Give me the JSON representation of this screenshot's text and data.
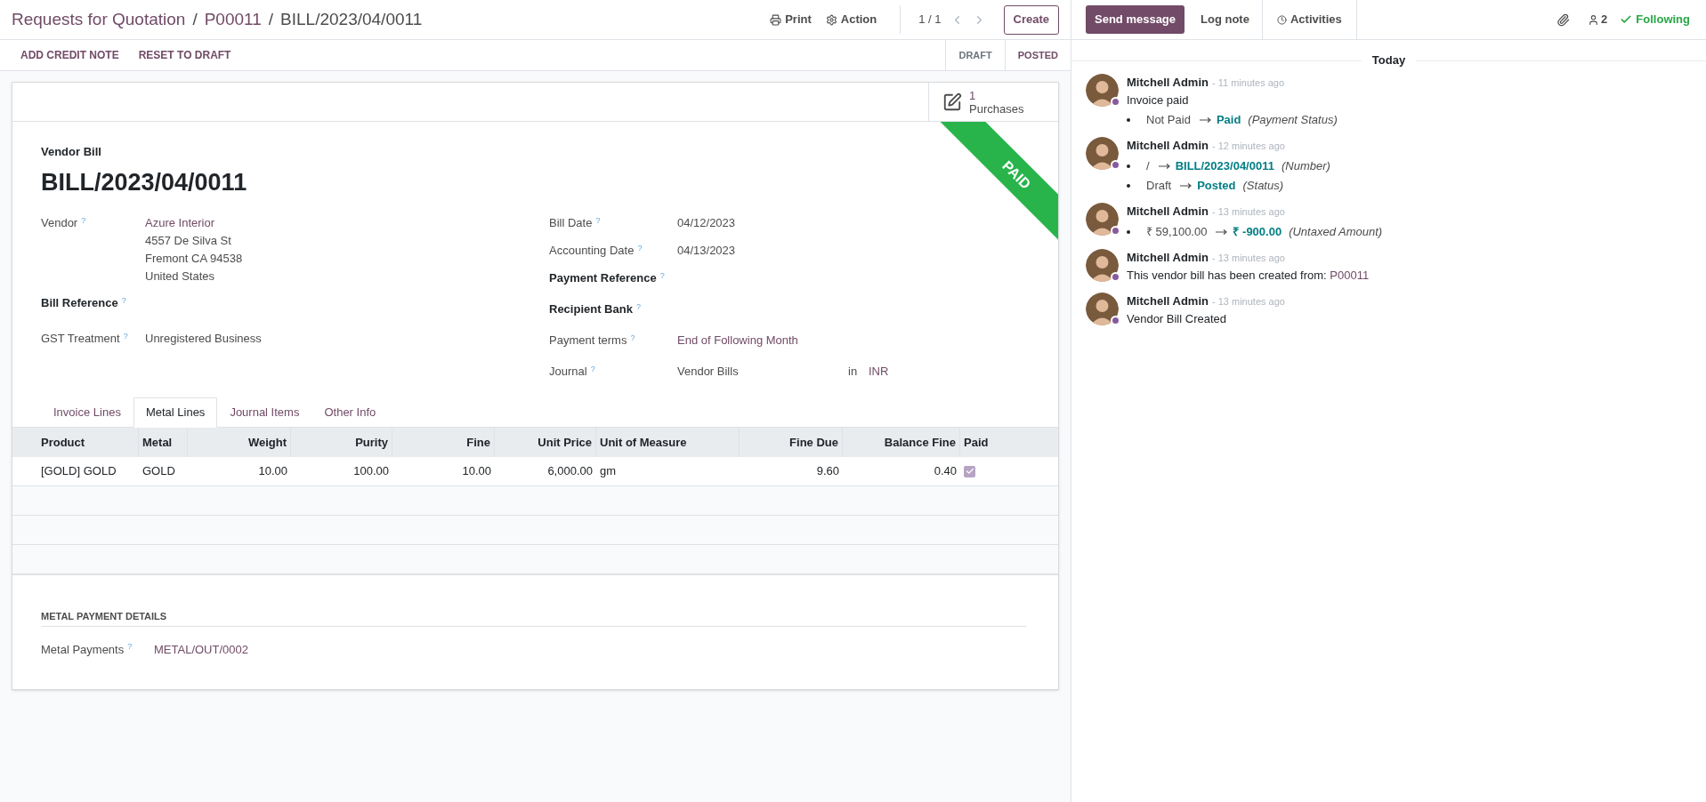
{
  "breadcrumbs": [
    {
      "label": "Requests for Quotation",
      "kind": "link"
    },
    {
      "label": "P00011",
      "kind": "link"
    },
    {
      "label": "BILL/2023/04/0011",
      "kind": "current"
    }
  ],
  "toolbar": {
    "print": "Print",
    "action": "Action",
    "pager": "1 / 1",
    "create": "Create"
  },
  "actions": [
    "ADD CREDIT NOTE",
    "RESET TO DRAFT"
  ],
  "stages": [
    {
      "label": "DRAFT",
      "selected": false
    },
    {
      "label": "POSTED",
      "selected": true
    }
  ],
  "smart_button": {
    "count": "1",
    "label": "Purchases"
  },
  "ribbon": "PAID",
  "document": {
    "type": "Vendor Bill",
    "number": "BILL/2023/04/0011"
  },
  "left_fields": [
    {
      "label": "Vendor",
      "required": false,
      "kind": "address",
      "value": "Azure Interior",
      "lines": [
        "4557 De Silva St",
        "Fremont CA 94538",
        "United States"
      ]
    },
    {
      "label": "Bill Reference",
      "required": true,
      "kind": "empty"
    },
    {
      "label": "GST Treatment",
      "required": false,
      "kind": "text",
      "value": "Unregistered Business"
    }
  ],
  "right_fields": [
    {
      "label": "Bill Date",
      "required": false,
      "kind": "text",
      "value": "04/12/2023"
    },
    {
      "label": "Accounting Date",
      "required": false,
      "kind": "text",
      "value": "04/13/2023"
    },
    {
      "label": "Payment Reference",
      "required": true,
      "kind": "empty"
    },
    {
      "label": "Recipient Bank",
      "required": true,
      "kind": "empty"
    },
    {
      "label": "Payment terms",
      "required": false,
      "kind": "link",
      "value": "End of Following Month"
    },
    {
      "label": "Journal",
      "required": false,
      "kind": "currency",
      "value": "Vendor Bills",
      "joiner": "in",
      "currency": "INR"
    }
  ],
  "tabs": [
    {
      "label": "Invoice Lines",
      "selected": false
    },
    {
      "label": "Metal Lines",
      "selected": true
    },
    {
      "label": "Journal Items",
      "selected": false
    },
    {
      "label": "Other Info",
      "selected": false
    }
  ],
  "table": {
    "columns": [
      {
        "label": "Product",
        "kind": "text"
      },
      {
        "label": "Metal",
        "kind": "text"
      },
      {
        "label": "Weight",
        "kind": "number"
      },
      {
        "label": "Purity",
        "kind": "number"
      },
      {
        "label": "Fine",
        "kind": "number"
      },
      {
        "label": "Unit Price",
        "kind": "number"
      },
      {
        "label": "Unit of Measure",
        "kind": "text"
      },
      {
        "label": "Fine Due",
        "kind": "number"
      },
      {
        "label": "Balance Fine",
        "kind": "number"
      },
      {
        "label": "Paid",
        "kind": "check"
      }
    ],
    "rows": [
      {
        "cells": [
          "[GOLD] GOLD",
          "GOLD",
          "10.00",
          "100.00",
          "10.00",
          "6,000.00",
          "gm",
          "9.60",
          "0.40"
        ],
        "paid": true
      }
    ]
  },
  "payment_section": {
    "title": "METAL PAYMENT DETAILS",
    "label": "Metal Payments",
    "help": "?",
    "value": "METAL/OUT/0002"
  },
  "help_mark": "?",
  "breadcrumb_separator": "/",
  "chatter": {
    "buttons": [
      {
        "label": "Send message",
        "kind": "primary"
      },
      {
        "label": "Log note",
        "kind": "plain"
      },
      {
        "label": "Activities",
        "kind": "activity"
      }
    ],
    "followers": "2",
    "following": "Following",
    "day": "Today",
    "messages": [
      {
        "author": "Mitchell Admin",
        "time": "- 11 minutes ago",
        "body": "Invoice paid",
        "tracking": [
          {
            "old": "Not Paid",
            "new": "Paid",
            "field": "(Payment Status)"
          }
        ]
      },
      {
        "author": "Mitchell Admin",
        "time": "- 12 minutes ago",
        "tracking": [
          {
            "old": "/",
            "new": "BILL/2023/04/0011",
            "field": "(Number)"
          },
          {
            "old": "Draft",
            "new": "Posted",
            "field": "(Status)"
          }
        ]
      },
      {
        "author": "Mitchell Admin",
        "time": "- 13 minutes ago",
        "tracking": [
          {
            "old": "₹ 59,100.00",
            "new": "₹ -900.00",
            "field": "(Untaxed Amount)"
          }
        ]
      },
      {
        "author": "Mitchell Admin",
        "time": "- 13 minutes ago",
        "body": "This vendor bill has been created from:",
        "link": "P00011"
      },
      {
        "author": "Mitchell Admin",
        "time": "- 13 minutes ago",
        "body": "Vendor Bill Created"
      }
    ]
  }
}
